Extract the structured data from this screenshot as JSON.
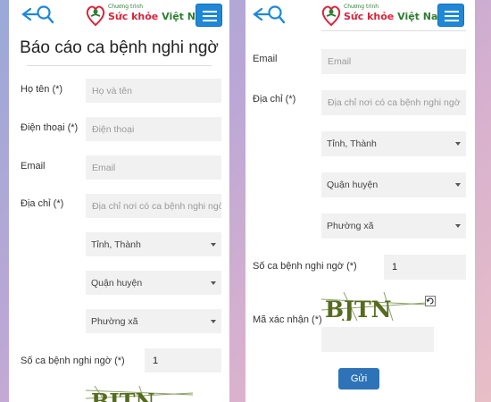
{
  "brand": {
    "small": "Chương trình",
    "name_part1": "Sức khỏe",
    "name_part2": "Việt Nam"
  },
  "form": {
    "title": "Báo cáo ca bệnh nghi ngờ",
    "name_label": "Họ tên (*)",
    "name_placeholder": "Họ và tên",
    "phone_label": "Điện thoại (*)",
    "phone_placeholder": "Điện thoại",
    "email_label": "Email",
    "email_placeholder": "Email",
    "address_label": "Địa chỉ (*)",
    "address_placeholder": "Địa chỉ nơi có ca bệnh nghi ngờ",
    "province_selected": "Tỉnh, Thành",
    "district_selected": "Quận huyện",
    "ward_selected": "Phường xã",
    "cases_label": "Số ca bệnh nghi ngờ (*)",
    "cases_value": "1",
    "captcha_label": "Mã xác nhận (*)",
    "captcha_text": "BJTN",
    "submit_label": "Gửi"
  },
  "colors": {
    "accent": "#1e88d8",
    "submit": "#2e73b8",
    "field_bg": "#f1f1f1"
  }
}
